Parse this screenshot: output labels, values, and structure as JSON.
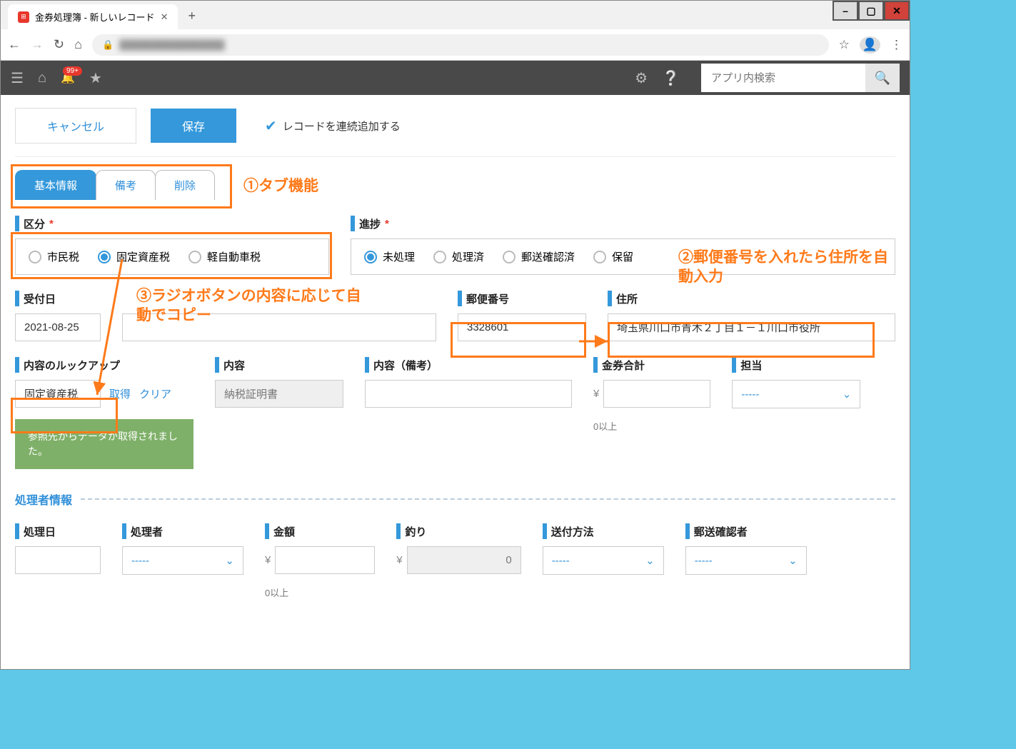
{
  "window": {
    "tab_title": "金券処理簿 - 新しいレコード",
    "min": "–",
    "max": "▢",
    "close": "✕"
  },
  "browser": {
    "back": "←",
    "fwd": "→",
    "reload": "↻",
    "home_icon": "⌂",
    "lock": "🔒",
    "url_blur": "████████████████",
    "star": "☆",
    "avatar": "👤",
    "menu": "⋮"
  },
  "topbar": {
    "badge": "99+",
    "search_ph": "アプリ内検索"
  },
  "actions": {
    "cancel": "キャンセル",
    "save": "保存",
    "continuous": "レコードを連続追加する"
  },
  "tabs": [
    "基本情報",
    "備考",
    "削除"
  ],
  "labels": {
    "kubun": "区分",
    "shinchoku": "進捗",
    "uketsukebi": "受付日",
    "yubin": "郵便番号",
    "jusho": "住所",
    "lookup": "内容のルックアップ",
    "naiyo": "内容",
    "naiyo_biko": "内容（備考）",
    "kinken_goukei": "金券合計",
    "tantou": "担当",
    "shori_info": "処理者情報",
    "shoribi": "処理日",
    "shorisha": "処理者",
    "kingaku": "金額",
    "tsuri": "釣り",
    "soufu": "送付方法",
    "yusou_kakunin": "郵送確認者"
  },
  "kubun_opts": [
    "市民税",
    "固定資産税",
    "軽自動車税"
  ],
  "kubun_sel": 1,
  "shinchoku_opts": [
    "未処理",
    "処理済",
    "郵送確認済",
    "保留"
  ],
  "shinchoku_sel": 0,
  "values": {
    "uketsukebi": "2021-08-25",
    "yubin": "3328601",
    "jusho": "埼玉県川口市青木２丁目１－１川口市役所",
    "lookup_val": "固定資産税",
    "naiyo_val": "納税証明書",
    "tsuri_val": "0",
    "select_dash": "-----",
    "zero_ijo": "0以上"
  },
  "links": {
    "get": "取得",
    "clear": "クリア"
  },
  "toast": "参照先からデータが取得されました。",
  "annotations": {
    "a1": "①タブ機能",
    "a2": "②郵便番号を入れたら住所を自動入力",
    "a3": "③ラジオボタンの内容に応じて自動でコピー"
  }
}
